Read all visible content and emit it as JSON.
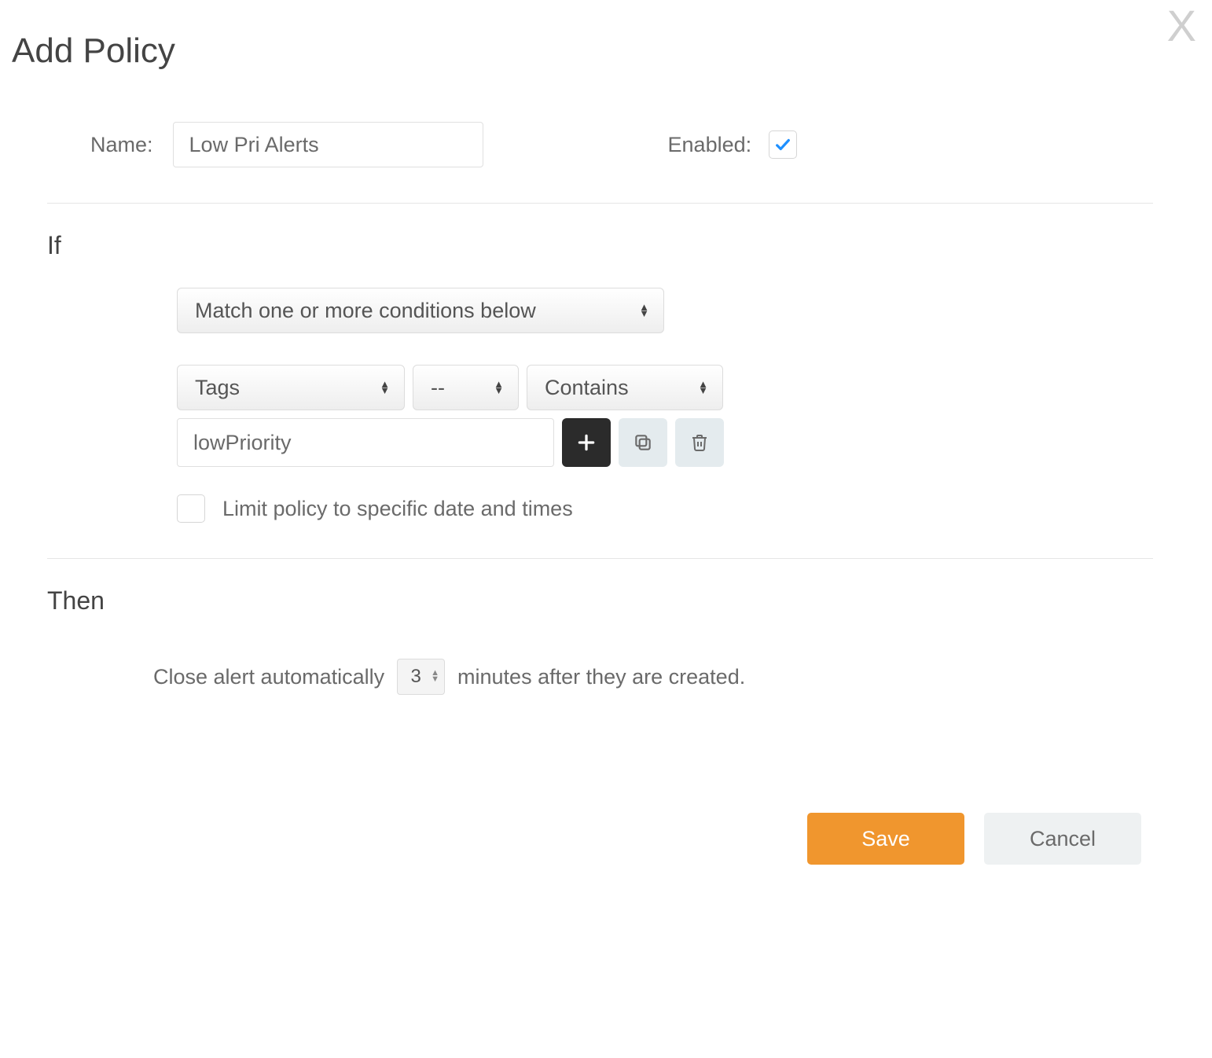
{
  "dialog": {
    "title": "Add Policy",
    "close_glyph": "X"
  },
  "top": {
    "name_label": "Name:",
    "name_value": "Low Pri Alerts",
    "enabled_label": "Enabled:",
    "enabled_checked": true
  },
  "if": {
    "heading": "If",
    "match_select": "Match one or more conditions below",
    "condition": {
      "field": "Tags",
      "op": "--",
      "comparator": "Contains",
      "value": "lowPriority"
    },
    "limit_label": "Limit policy to specific date and times",
    "limit_checked": false
  },
  "then": {
    "heading": "Then",
    "prefix": "Close alert automatically",
    "minutes": "3",
    "suffix": "minutes after they are created."
  },
  "footer": {
    "save": "Save",
    "cancel": "Cancel"
  },
  "colors": {
    "accent": "#f0962e",
    "check": "#1e90ff"
  }
}
